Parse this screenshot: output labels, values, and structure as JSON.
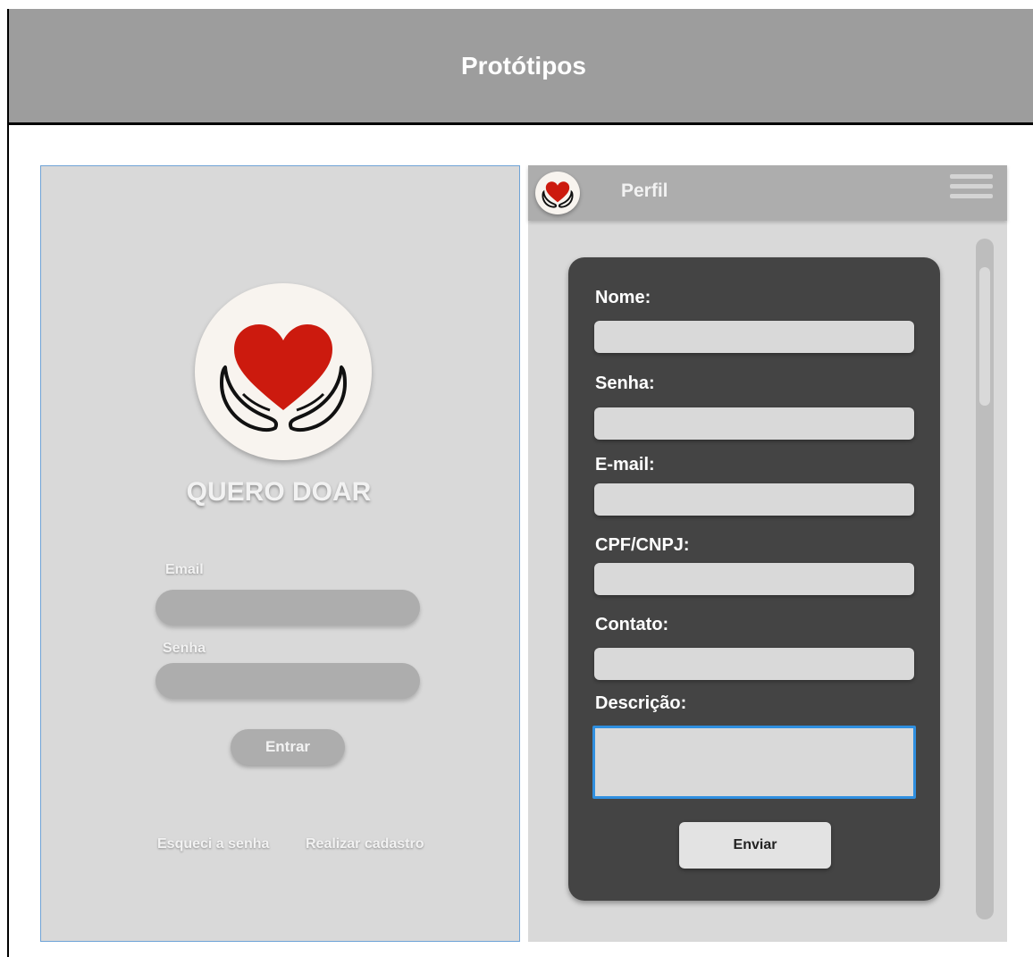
{
  "header": {
    "title": "Protótipos"
  },
  "login": {
    "app_title": "QUERO DOAR",
    "email_label": "Email",
    "password_label": "Senha",
    "submit_label": "Entrar",
    "forgot_link": "Esqueci a senha",
    "register_link": "Realizar cadastro"
  },
  "profile": {
    "title": "Perfil",
    "fields": {
      "name_label": "Nome:",
      "password_label": "Senha:",
      "email_label": "E-mail:",
      "document_label": "CPF/CNPJ:",
      "contact_label": "Contato:",
      "description_label": "Descrição:"
    },
    "submit_label": "Enviar"
  },
  "colors": {
    "heart": "#cc1a0e",
    "panel_background": "#d9d9d9",
    "form_card": "#444444",
    "focus_border": "#2f8fe0"
  },
  "icons": [
    "heart-hands-logo-icon",
    "menu-icon"
  ]
}
